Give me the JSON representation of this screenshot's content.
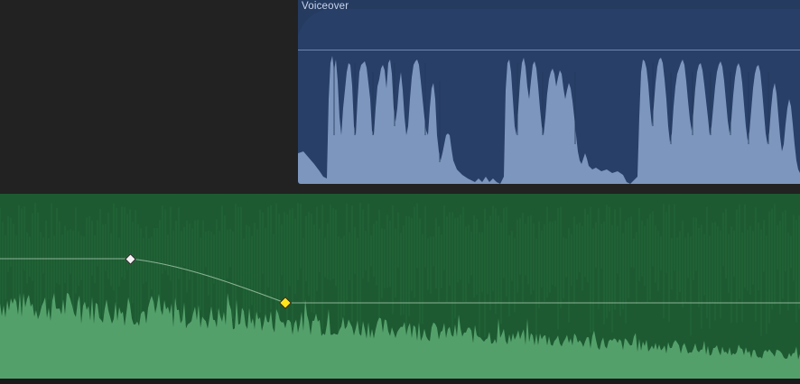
{
  "timeline": {
    "voiceover_clip": {
      "title": "Voiceover",
      "color": "#253b60",
      "wave_color": "#7d96bd"
    },
    "music_clip": {
      "color": "#1d5a31",
      "wave_color": "#54a06b",
      "keyframes": [
        {
          "type": "white",
          "state": "normal"
        },
        {
          "type": "yellow",
          "state": "selected"
        }
      ]
    }
  }
}
